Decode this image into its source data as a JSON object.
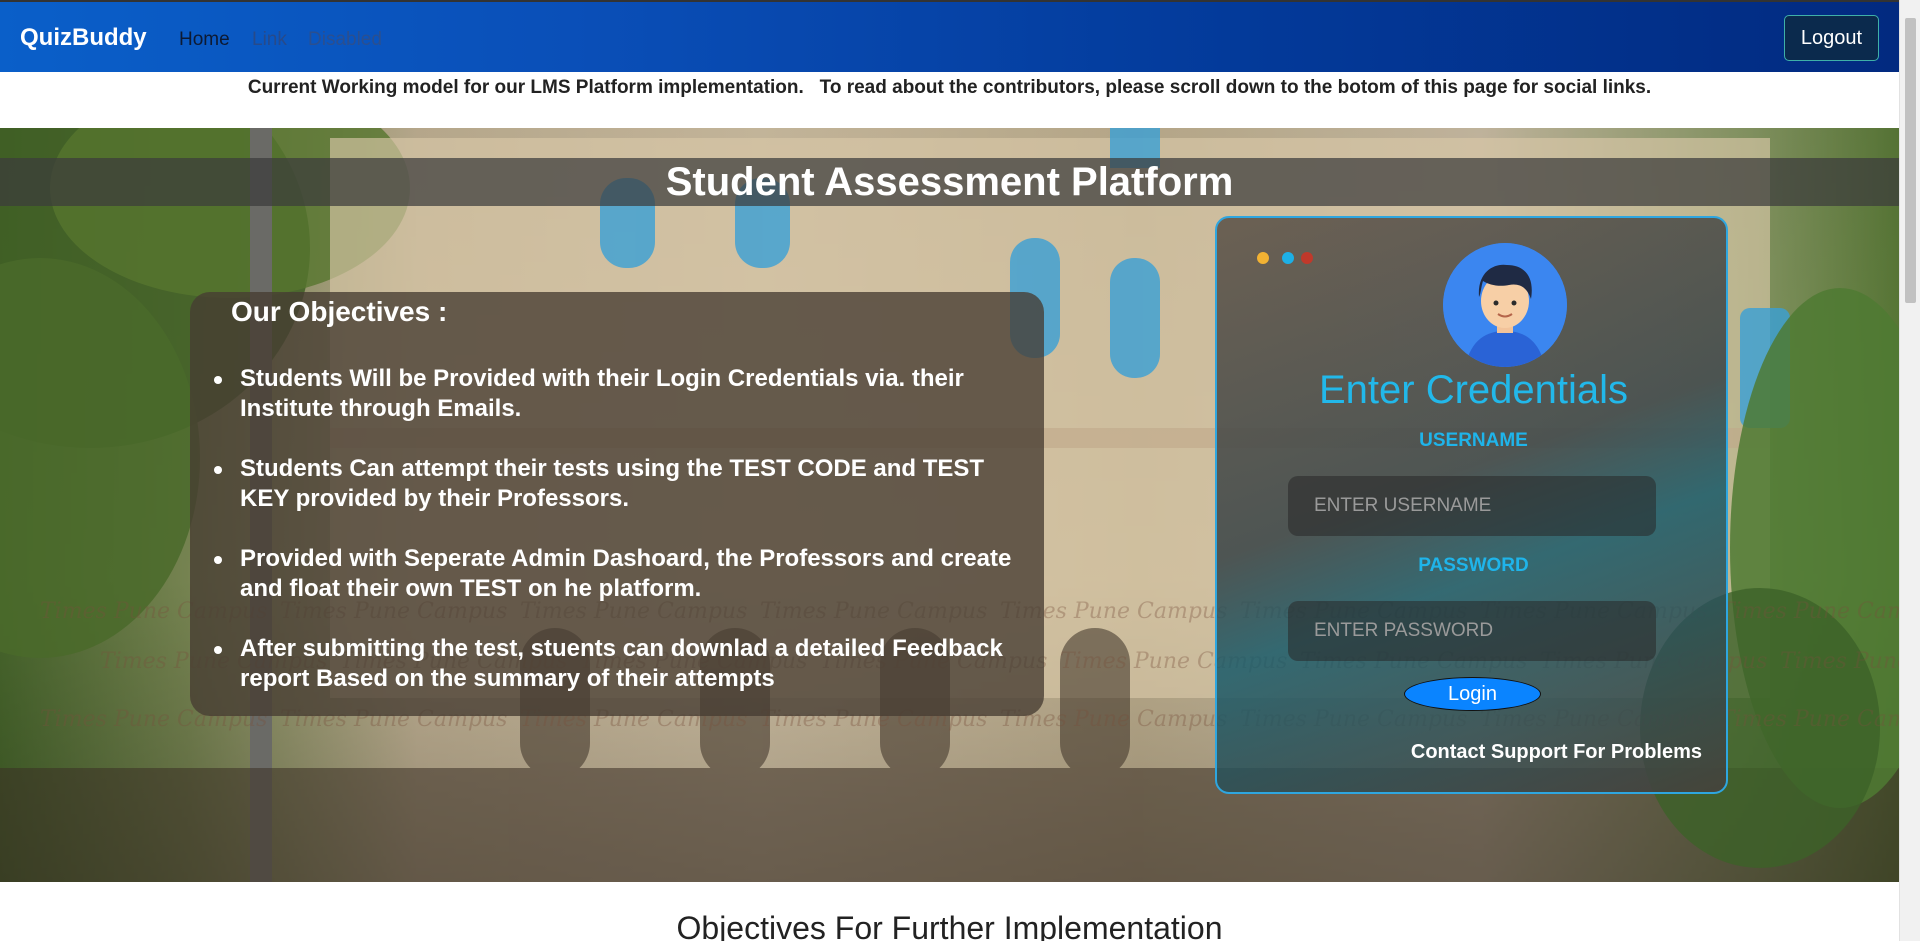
{
  "navbar": {
    "brand": "QuizBuddy",
    "links": [
      "Home",
      "Link",
      "Disabled"
    ],
    "logout_label": "Logout"
  },
  "info_bar": {
    "text": "Current Working model for our LMS Platform implementation.   To read about the contributors, please scroll down to the botom of this page for social links."
  },
  "hero": {
    "title": "Student Assessment Platform",
    "watermark": "Times Pune Campus"
  },
  "objectives": {
    "heading": "Our Objectives :",
    "items": [
      "Students Will be Provided with their Login Credentials via. their Institute through Emails.",
      "Students Can attempt their tests using the TEST CODE and TEST KEY provided by their Professors.",
      "Provided with Seperate Admin Dashoard, the Professors and create and float their own TEST on he platform.",
      "After submitting the test, stuents can downlad a detailed Feedback report Based on the summary of their attempts"
    ]
  },
  "login": {
    "title": "Enter Credentials",
    "username_label": "USERNAME",
    "username_placeholder": "ENTER USERNAME",
    "password_label": "PASSWORD",
    "password_placeholder": "ENTER PASSWORD",
    "login_label": "Login",
    "support_label": "Contact Support For Problems",
    "dot_colors": [
      "#f2b233",
      "#1db0e6",
      "#c0392b"
    ],
    "avatar_icon": "user-avatar-icon"
  },
  "section": {
    "heading": "Objectives For Further Implementation"
  },
  "colors": {
    "accent": "#22b8ea",
    "login_button": "#0a84ff",
    "nav_gradient_start": "#0a5fc9",
    "nav_gradient_end": "#022a80"
  }
}
